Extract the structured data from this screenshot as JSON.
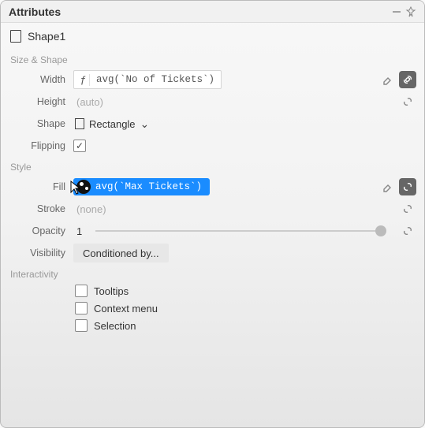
{
  "panel": {
    "title": "Attributes"
  },
  "object": {
    "name": "Shape1"
  },
  "sections": {
    "size_shape": "Size & Shape",
    "style": "Style",
    "interactivity": "Interactivity"
  },
  "labels": {
    "width": "Width",
    "height": "Height",
    "shape": "Shape",
    "flipping": "Flipping",
    "fill": "Fill",
    "stroke": "Stroke",
    "opacity": "Opacity",
    "visibility": "Visibility"
  },
  "values": {
    "width_expr": "avg(`No of Tickets`)",
    "height": "(auto)",
    "shape": "Rectangle",
    "flipping_checked": true,
    "fill_expr": "avg(`Max Tickets`)",
    "stroke": "(none)",
    "opacity": "1",
    "visibility_btn": "Conditioned by..."
  },
  "interactivity": {
    "tooltips": {
      "label": "Tooltips",
      "checked": false
    },
    "context_menu": {
      "label": "Context menu",
      "checked": false
    },
    "selection": {
      "label": "Selection",
      "checked": false
    }
  },
  "icons": {
    "eraser": "eraser-icon",
    "link": "link-icon",
    "fx": "fx"
  }
}
